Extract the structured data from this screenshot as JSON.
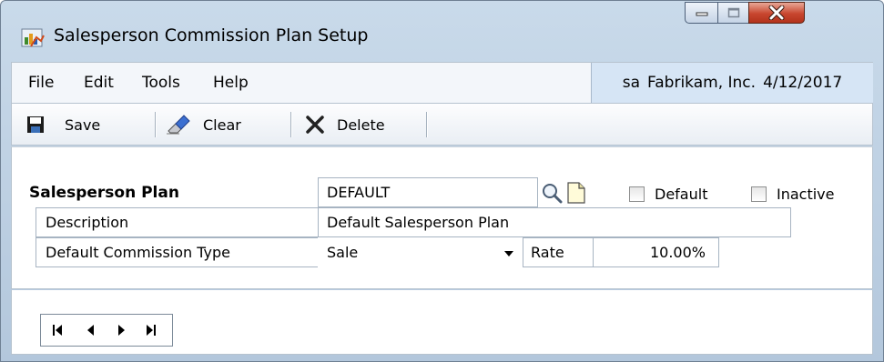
{
  "window": {
    "title": "Salesperson Commission Plan Setup",
    "icon": "commission-plan-app-icon"
  },
  "menu": {
    "items": [
      "File",
      "Edit",
      "Tools",
      "Help"
    ],
    "user": "sa",
    "company": "Fabrikam, Inc.",
    "date": "4/12/2017"
  },
  "toolbar": {
    "save_label": "Save",
    "clear_label": "Clear",
    "delete_label": "Delete"
  },
  "form": {
    "plan_label": "Salesperson Plan",
    "plan_value": "DEFAULT",
    "default_label": "Default",
    "default_checked": false,
    "inactive_label": "Inactive",
    "inactive_checked": false,
    "description_label": "Description",
    "description_value": "Default Salesperson Plan",
    "commission_type_label": "Default Commission Type",
    "commission_type_value": "Sale",
    "rate_label": "Rate",
    "rate_value": "10.00%"
  },
  "navigation": {
    "buttons": [
      "first-record",
      "previous-record",
      "next-record",
      "last-record"
    ]
  },
  "colors": {
    "frame": "#c9daea",
    "close_button": "#c8462f",
    "company_banner": "#d6e5f5",
    "delete_icon": "#222222"
  }
}
